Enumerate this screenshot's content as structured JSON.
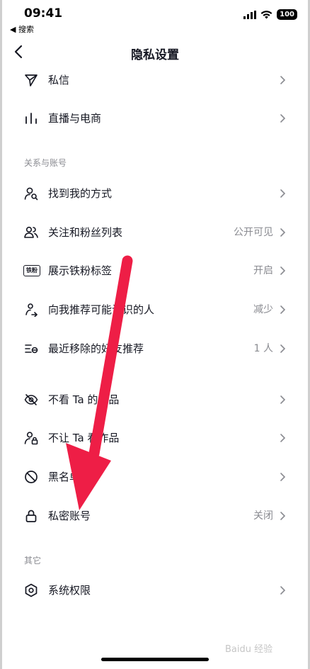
{
  "status_bar": {
    "time": "09:41",
    "back_app": "◀ 搜索",
    "battery": "100"
  },
  "nav": {
    "title": "隐私设置"
  },
  "sections": {
    "relations": "关系与账号",
    "other": "其它"
  },
  "rows": {
    "messages": {
      "label": "私信",
      "icon": "send-icon"
    },
    "live": {
      "label": "直播与电商",
      "icon": "bars-icon"
    },
    "find_me": {
      "label": "找到我的方式",
      "icon": "user-search-icon"
    },
    "follow_list": {
      "label": "关注和粉丝列表",
      "value": "公开可见",
      "icon": "users-icon"
    },
    "fan_badge": {
      "label": "展示铁粉标签",
      "value": "开启",
      "icon": "fan-badge-icon",
      "badge_text": "铁粉"
    },
    "recommend": {
      "label": "向我推荐可能认识的人",
      "value": "减少",
      "icon": "share-person-icon"
    },
    "removed": {
      "label": "最近移除的好友推荐",
      "value": "1 人",
      "icon": "list-remove-icon"
    },
    "hide_from": {
      "label": "不看 Ta 的作品",
      "icon": "eye-off-icon"
    },
    "block_view": {
      "label": "不让 Ta 看作品",
      "icon": "user-lock-icon"
    },
    "blacklist": {
      "label": "黑名单",
      "icon": "block-icon"
    },
    "private": {
      "label": "私密账号",
      "value": "关闭",
      "icon": "lock-icon"
    },
    "permissions": {
      "label": "系统权限",
      "icon": "hexagon-settings-icon"
    }
  },
  "watermark": "Baidu 经验",
  "colors": {
    "text": "#161823",
    "muted": "#8a8b91",
    "arrow": "#ee1e46"
  }
}
